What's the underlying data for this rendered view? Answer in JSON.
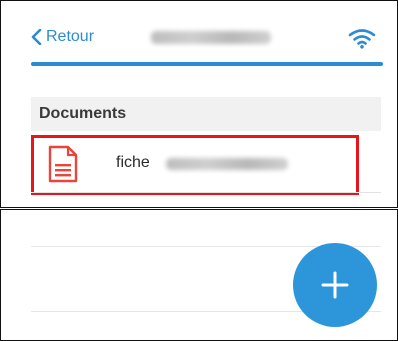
{
  "header": {
    "back_label": "Retour",
    "back_icon": "chevron-left-icon",
    "status_icon": "wifi-icon"
  },
  "documents": {
    "section_title": "Documents",
    "items": [
      {
        "label": "fiche",
        "icon": "pdf-document-icon",
        "highlighted": true
      }
    ]
  },
  "actions": {
    "add_icon": "plus-icon"
  },
  "colors": {
    "accent": "#2d8bd1",
    "fab": "#2d96da",
    "highlight": "#e8141c",
    "document_icon": "#e8453c",
    "section_background": "#f1f1f1"
  }
}
